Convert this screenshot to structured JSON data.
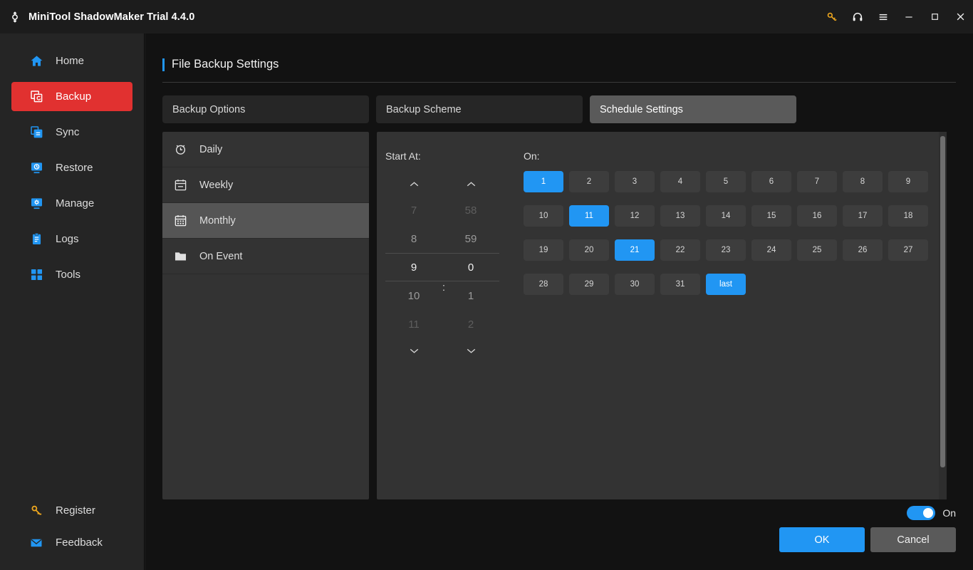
{
  "window": {
    "title": "MiniTool ShadowMaker Trial 4.4.0",
    "logo_icon": "refresh-arrows-logo",
    "controls": [
      {
        "name": "key-icon",
        "label": ""
      },
      {
        "name": "headset-icon",
        "label": ""
      },
      {
        "name": "hamburger-menu-icon",
        "label": ""
      },
      {
        "name": "minimize-icon",
        "label": ""
      },
      {
        "name": "maximize-icon",
        "label": ""
      },
      {
        "name": "close-icon",
        "label": ""
      }
    ]
  },
  "sidebar": {
    "items": [
      {
        "label": "Home",
        "icon": "home-icon",
        "active": false
      },
      {
        "label": "Backup",
        "icon": "backup-icon",
        "active": true
      },
      {
        "label": "Sync",
        "icon": "sync-icon",
        "active": false
      },
      {
        "label": "Restore",
        "icon": "restore-icon",
        "active": false
      },
      {
        "label": "Manage",
        "icon": "manage-icon",
        "active": false
      },
      {
        "label": "Logs",
        "icon": "logs-icon",
        "active": false
      },
      {
        "label": "Tools",
        "icon": "tools-icon",
        "active": false
      }
    ],
    "bottom_items": [
      {
        "label": "Register",
        "icon": "key-icon"
      },
      {
        "label": "Feedback",
        "icon": "envelope-icon"
      }
    ]
  },
  "page": {
    "title": "File Backup Settings"
  },
  "tabs": [
    {
      "label": "Backup Options",
      "active": false
    },
    {
      "label": "Backup Scheme",
      "active": false
    },
    {
      "label": "Schedule Settings",
      "active": true
    }
  ],
  "schedule_types": [
    {
      "label": "Daily",
      "icon": "alarm-clock-icon",
      "active": false
    },
    {
      "label": "Weekly",
      "icon": "calendar-icon",
      "active": false
    },
    {
      "label": "Monthly",
      "icon": "calendar-grid-icon",
      "active": true
    },
    {
      "label": "On Event",
      "icon": "folder-icon",
      "active": false
    }
  ],
  "start_at": {
    "label": "Start At:",
    "separator": ":",
    "hours": [
      {
        "value": "7",
        "state": "dim"
      },
      {
        "value": "8",
        "state": "normal"
      },
      {
        "value": "9",
        "state": "selected"
      },
      {
        "value": "10",
        "state": "normal"
      },
      {
        "value": "11",
        "state": "dim"
      }
    ],
    "minutes": [
      {
        "value": "58",
        "state": "dim"
      },
      {
        "value": "59",
        "state": "normal"
      },
      {
        "value": "0",
        "state": "selected"
      },
      {
        "value": "1",
        "state": "normal"
      },
      {
        "value": "2",
        "state": "dim"
      }
    ],
    "selected_hour": "9",
    "selected_minute": "0"
  },
  "on_days": {
    "label": "On:",
    "rows": [
      [
        {
          "label": "1",
          "selected": true
        },
        {
          "label": "2",
          "selected": false
        },
        {
          "label": "3",
          "selected": false
        },
        {
          "label": "4",
          "selected": false
        },
        {
          "label": "5",
          "selected": false
        },
        {
          "label": "6",
          "selected": false
        },
        {
          "label": "7",
          "selected": false
        },
        {
          "label": "8",
          "selected": false
        },
        {
          "label": "9",
          "selected": false
        }
      ],
      [
        {
          "label": "10",
          "selected": false
        },
        {
          "label": "11",
          "selected": true
        },
        {
          "label": "12",
          "selected": false
        },
        {
          "label": "13",
          "selected": false
        },
        {
          "label": "14",
          "selected": false
        },
        {
          "label": "15",
          "selected": false
        },
        {
          "label": "16",
          "selected": false
        },
        {
          "label": "17",
          "selected": false
        },
        {
          "label": "18",
          "selected": false
        }
      ],
      [
        {
          "label": "19",
          "selected": false
        },
        {
          "label": "20",
          "selected": false
        },
        {
          "label": "21",
          "selected": true
        },
        {
          "label": "22",
          "selected": false
        },
        {
          "label": "23",
          "selected": false
        },
        {
          "label": "24",
          "selected": false
        },
        {
          "label": "25",
          "selected": false
        },
        {
          "label": "26",
          "selected": false
        },
        {
          "label": "27",
          "selected": false
        }
      ],
      [
        {
          "label": "28",
          "selected": false
        },
        {
          "label": "29",
          "selected": false
        },
        {
          "label": "30",
          "selected": false
        },
        {
          "label": "31",
          "selected": false
        },
        {
          "label": "last",
          "selected": true
        }
      ]
    ]
  },
  "footer": {
    "toggle_state_label": "On",
    "toggle_on": true,
    "ok_label": "OK",
    "cancel_label": "Cancel"
  },
  "colors": {
    "accent_blue": "#2196f3",
    "accent_red": "#e13130",
    "accent_gold": "#f0a81e",
    "panel_bg": "#333333",
    "app_bg": "#121212",
    "sidebar_bg": "#252525"
  }
}
